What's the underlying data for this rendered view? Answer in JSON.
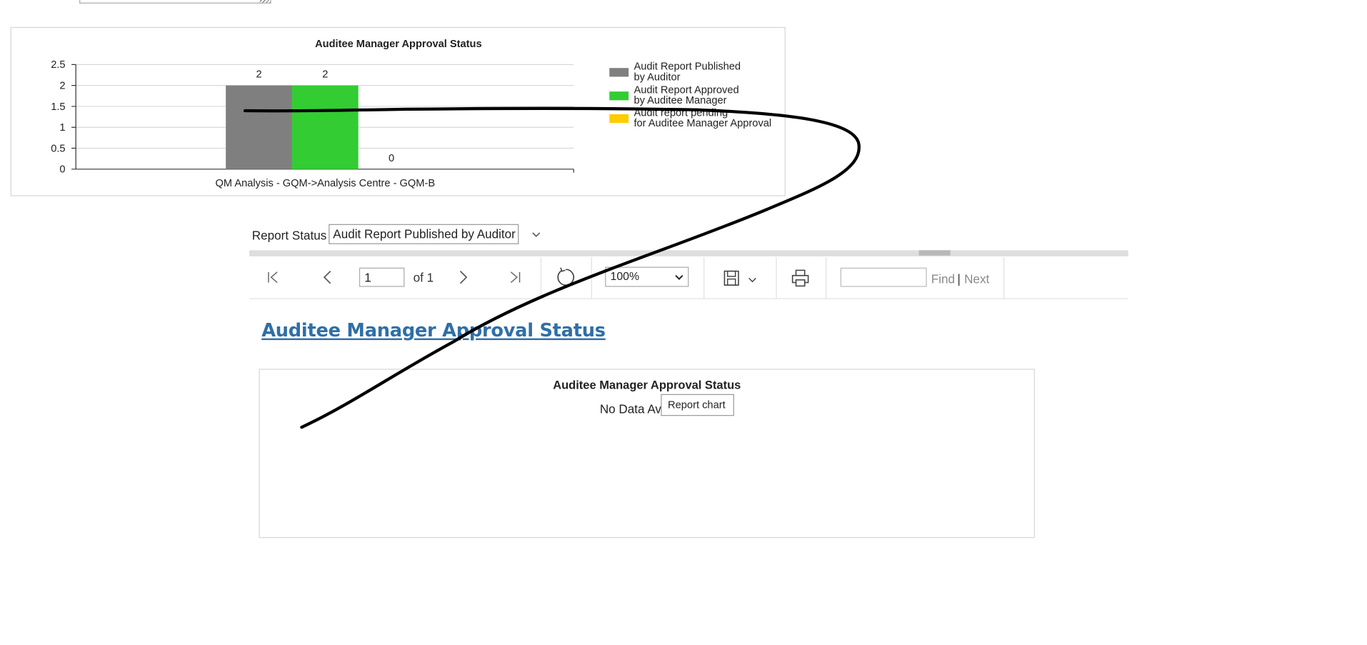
{
  "chart1": {
    "title": "Auditee Manager Approval Status"
  },
  "chart_data": {
    "type": "bar",
    "title": "Auditee Manager Approval Status",
    "categories": [
      "QM Analysis - GQM->Analysis Centre - GQM-B"
    ],
    "xlabel": "",
    "ylabel": "",
    "ylim": [
      0,
      2.5
    ],
    "yticks": [
      "0",
      "0.5",
      "1",
      "1.5",
      "2",
      "2.5"
    ],
    "grid": true,
    "legend_position": "right",
    "series": [
      {
        "name": "Audit Report Published by Auditor",
        "values": [
          2
        ],
        "color": "#7f7f7f",
        "data_label": "2"
      },
      {
        "name": "Audit Report Approved by Auditee Manager",
        "values": [
          2
        ],
        "color": "#33cc33",
        "data_label": "2"
      },
      {
        "name": "Audit report pending for Auditee Manager Approval",
        "values": [
          0
        ],
        "color": "#ffcc00",
        "data_label": "0"
      }
    ]
  },
  "params": {
    "report_status_label": "Report Status",
    "report_status_value": "Audit Report Published by Auditor"
  },
  "toolbar": {
    "page_value": "1",
    "of_label": "of 1",
    "zoom_value": "100%",
    "zoom_options": [
      "100%"
    ],
    "find_label": "Find",
    "pipe": "|",
    "next_label": "Next"
  },
  "report": {
    "heading_link": "Auditee Manager Approval Status",
    "chart_title": "Auditee Manager Approval Status",
    "no_data_text": "No Data Av",
    "tooltip": "Report chart"
  },
  "colors": {
    "link": "#2f6fa7",
    "ink_stroke": "#000000"
  }
}
